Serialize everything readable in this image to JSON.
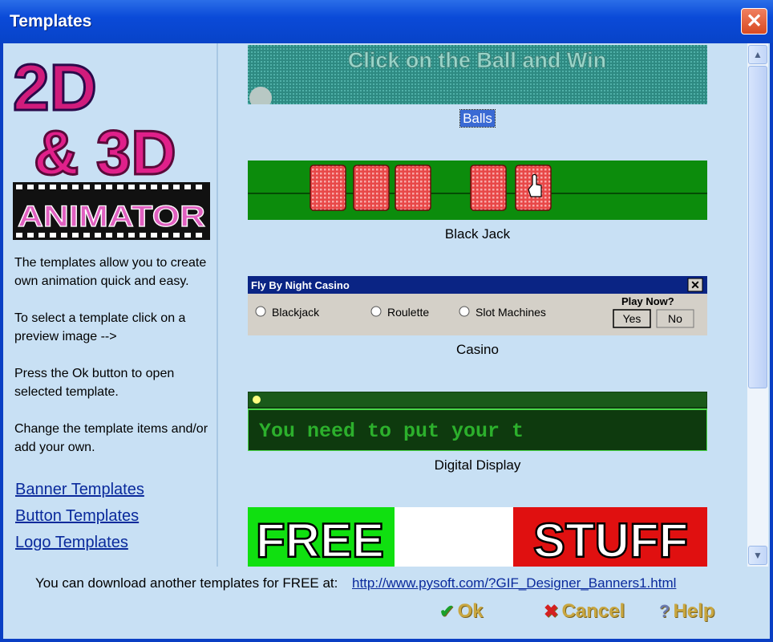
{
  "window": {
    "title": "Templates"
  },
  "logo": {
    "line1": "2D",
    "line2": "& 3D",
    "line3": "ANIMATOR"
  },
  "sidebar": {
    "paragraphs": [
      "The templates allow you to create own animation quick and easy.",
      "To select a template click on a preview image -->",
      "Press the Ok button to open selected template.",
      "Change the template items and/or add your own."
    ],
    "links": [
      "Banner Templates",
      "Button Templates",
      "Logo Templates"
    ]
  },
  "templates": [
    {
      "caption": "Balls",
      "banner_text": "Click on the Ball and Win",
      "selected": true
    },
    {
      "caption": "Black Jack"
    },
    {
      "caption": "Casino",
      "casino": {
        "title": "Fly By Night Casino",
        "options": [
          "Blackjack",
          "Roulette",
          "Slot Machines"
        ],
        "question": "Play Now?",
        "yes": "Yes",
        "no": "No"
      }
    },
    {
      "caption": "Digital Display",
      "display_text": "You need to put your t"
    },
    {
      "caption": "",
      "left_word": "FREE",
      "right_word": "STUFF"
    }
  ],
  "footer": {
    "download_text": "You can download another templates for FREE at:",
    "url": "http://www.pysoft.com/?GIF_Designer_Banners1.html",
    "ok": "Ok",
    "cancel": "Cancel",
    "help": "Help"
  },
  "colors": {
    "titlebar": "#0a4ad8",
    "window_bg": "#c8e0f4",
    "link": "#0a2a9c",
    "button_text": "#c8a640"
  }
}
